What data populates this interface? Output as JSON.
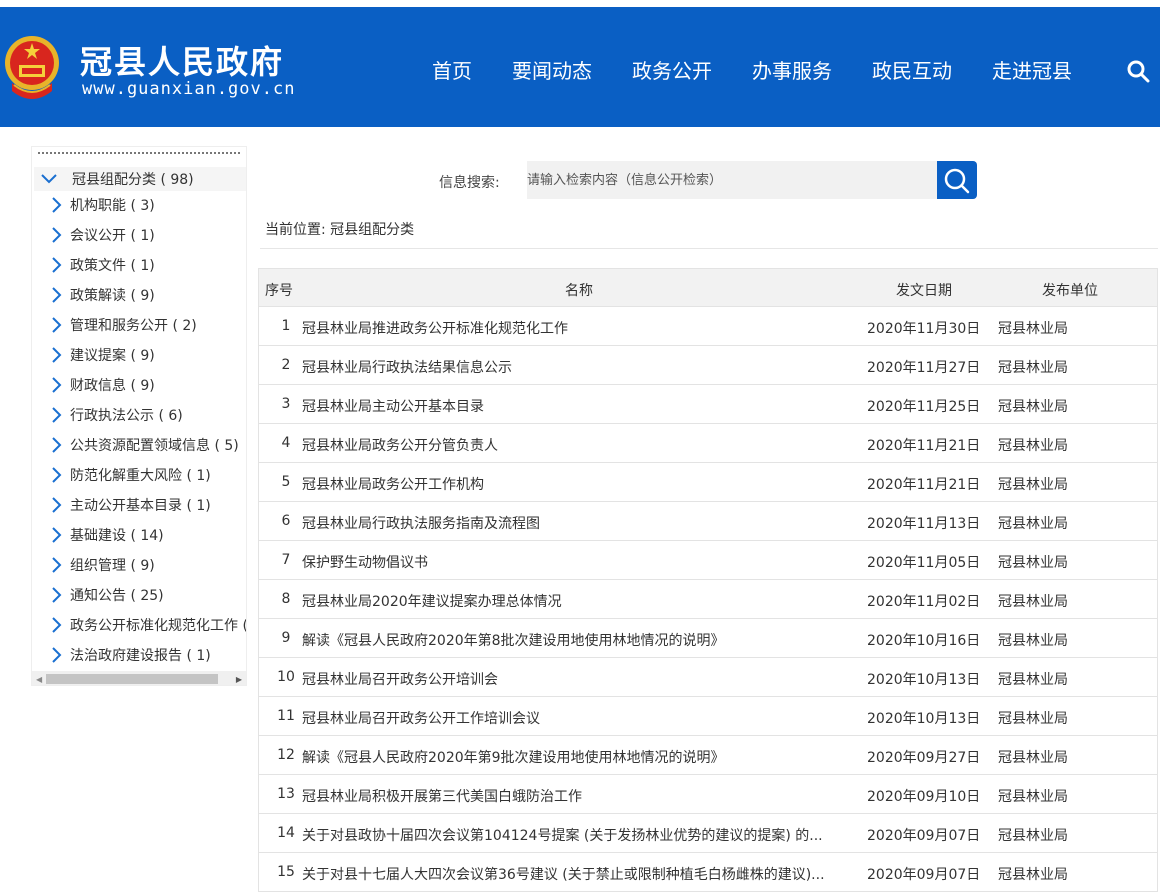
{
  "header": {
    "site_title": "冠县人民政府",
    "site_url": "www.guanxian.gov.cn",
    "nav": [
      "首页",
      "要闻动态",
      "政务公开",
      "办事服务",
      "政民互动",
      "走进冠县"
    ],
    "search_icon": "search-icon",
    "brand_color": "#0a5fc4"
  },
  "sidebar": {
    "root": "冠县组配分类 ( 98)",
    "items": [
      "机构职能 ( 3)",
      "会议公开 ( 1)",
      "政策文件 ( 1)",
      "政策解读 ( 9)",
      "管理和服务公开 ( 2)",
      "建议提案 ( 9)",
      "财政信息 ( 9)",
      "行政执法公示 ( 6)",
      "公共资源配置领域信息 ( 5)",
      "防范化解重大风险 ( 1)",
      "主动公开基本目录 ( 1)",
      "基础建设 ( 14)",
      "组织管理 ( 9)",
      "通知公告 ( 25)",
      "政务公开标准化规范化工作 (",
      "法治政府建设报告 ( 1)"
    ]
  },
  "search": {
    "label": "信息搜索:",
    "placeholder": "请输入检索内容（信息公开检索）"
  },
  "breadcrumb": "当前位置: 冠县组配分类",
  "table": {
    "headers": {
      "idx": "序号",
      "name": "名称",
      "date": "发文日期",
      "unit": "发布单位"
    },
    "rows": [
      {
        "idx": "1",
        "name": "冠县林业局推进政务公开标准化规范化工作",
        "date": "2020年11月30日",
        "unit": "冠县林业局"
      },
      {
        "idx": "2",
        "name": "冠县林业局行政执法结果信息公示",
        "date": "2020年11月27日",
        "unit": "冠县林业局"
      },
      {
        "idx": "3",
        "name": "冠县林业局主动公开基本目录",
        "date": "2020年11月25日",
        "unit": "冠县林业局"
      },
      {
        "idx": "4",
        "name": "冠县林业局政务公开分管负责人",
        "date": "2020年11月21日",
        "unit": "冠县林业局"
      },
      {
        "idx": "5",
        "name": "冠县林业局政务公开工作机构",
        "date": "2020年11月21日",
        "unit": "冠县林业局"
      },
      {
        "idx": "6",
        "name": "冠县林业局行政执法服务指南及流程图",
        "date": "2020年11月13日",
        "unit": "冠县林业局"
      },
      {
        "idx": "7",
        "name": "保护野生动物倡议书",
        "date": "2020年11月05日",
        "unit": "冠县林业局"
      },
      {
        "idx": "8",
        "name": "冠县林业局2020年建议提案办理总体情况",
        "date": "2020年11月02日",
        "unit": "冠县林业局"
      },
      {
        "idx": "9",
        "name": "解读《冠县人民政府2020年第8批次建设用地使用林地情况的说明》",
        "date": "2020年10月16日",
        "unit": "冠县林业局"
      },
      {
        "idx": "10",
        "name": "冠县林业局召开政务公开培训会",
        "date": "2020年10月13日",
        "unit": "冠县林业局"
      },
      {
        "idx": "11",
        "name": "冠县林业局召开政务公开工作培训会议",
        "date": "2020年10月13日",
        "unit": "冠县林业局"
      },
      {
        "idx": "12",
        "name": "解读《冠县人民政府2020年第9批次建设用地使用林地情况的说明》",
        "date": "2020年09月27日",
        "unit": "冠县林业局"
      },
      {
        "idx": "13",
        "name": "冠县林业局积极开展第三代美国白蛾防治工作",
        "date": "2020年09月10日",
        "unit": "冠县林业局"
      },
      {
        "idx": "14",
        "name": "关于对县政协十届四次会议第104124号提案 (关于发扬林业优势的建议的提案) 的...",
        "date": "2020年09月07日",
        "unit": "冠县林业局"
      },
      {
        "idx": "15",
        "name": "关于对县十七届人大四次会议第36号建议 (关于禁止或限制种植毛白杨雌株的建议)...",
        "date": "2020年09月07日",
        "unit": "冠县林业局"
      }
    ]
  }
}
